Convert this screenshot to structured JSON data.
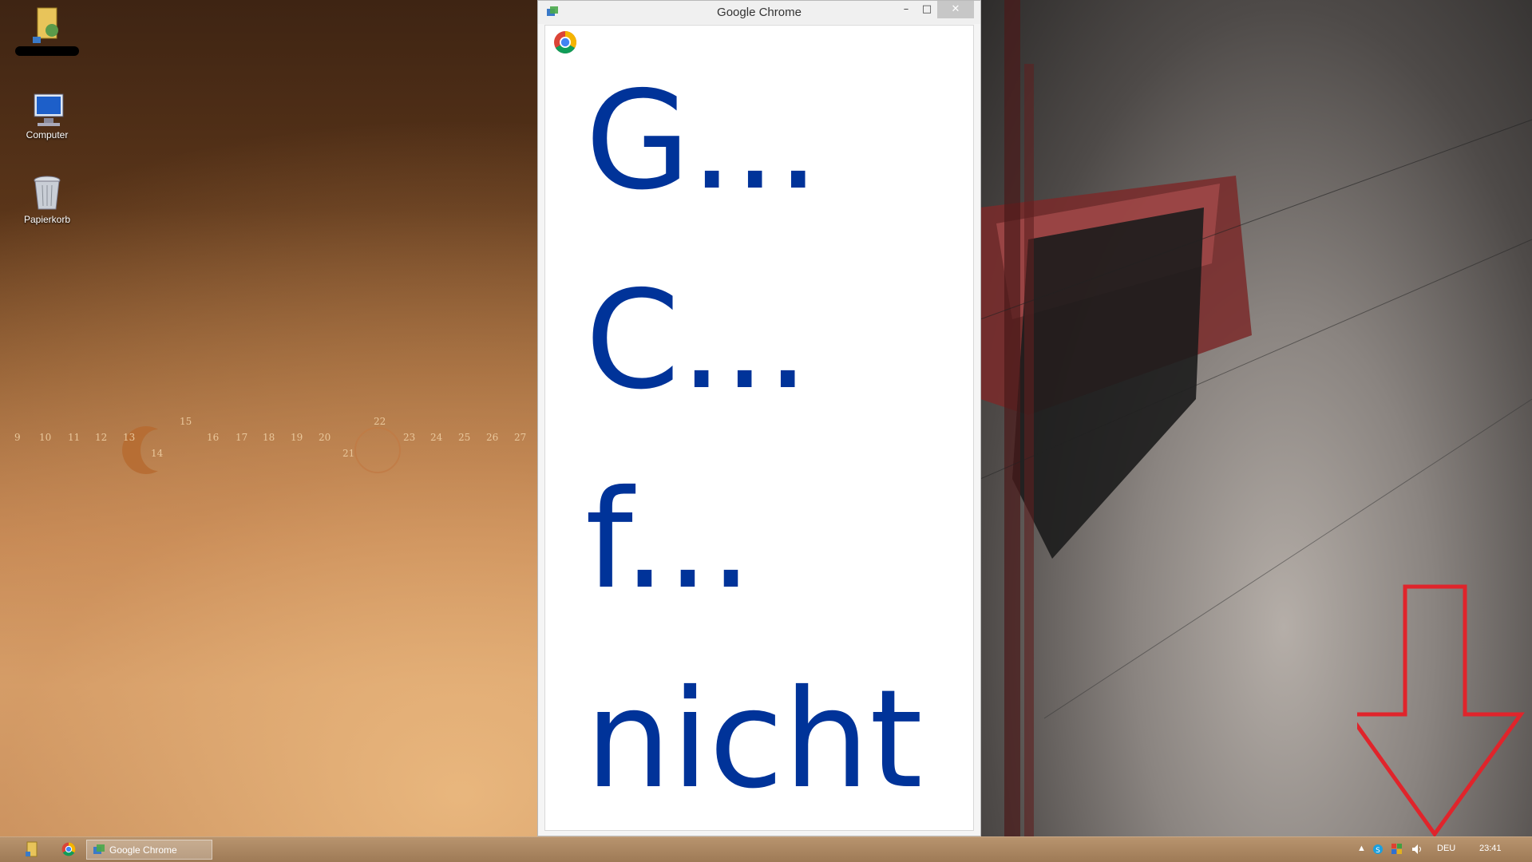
{
  "window": {
    "title": "Google Chrome",
    "minimize": "–",
    "maximize": "□",
    "close": "✕"
  },
  "content": {
    "lines": [
      "G...",
      "C...",
      "f...",
      "nicht"
    ],
    "text_color": "#003399"
  },
  "desktop": {
    "icons": [
      {
        "label": "",
        "icon": "user-folder-icon"
      },
      {
        "label": "Computer",
        "icon": "computer-icon"
      },
      {
        "label": "Papierkorb",
        "icon": "recycle-bin-icon"
      }
    ],
    "calendar_numbers": [
      "9",
      "10",
      "11",
      "12",
      "13",
      "14",
      "15",
      "16",
      "17",
      "18",
      "19",
      "20",
      "21",
      "22",
      "23",
      "24",
      "25",
      "26",
      "27"
    ]
  },
  "taskbar": {
    "task_label": "Google Chrome",
    "language": "DEU",
    "clock": "23:41",
    "tray_expand": "▲"
  },
  "colors": {
    "annotation_arrow": "#e0242b"
  }
}
